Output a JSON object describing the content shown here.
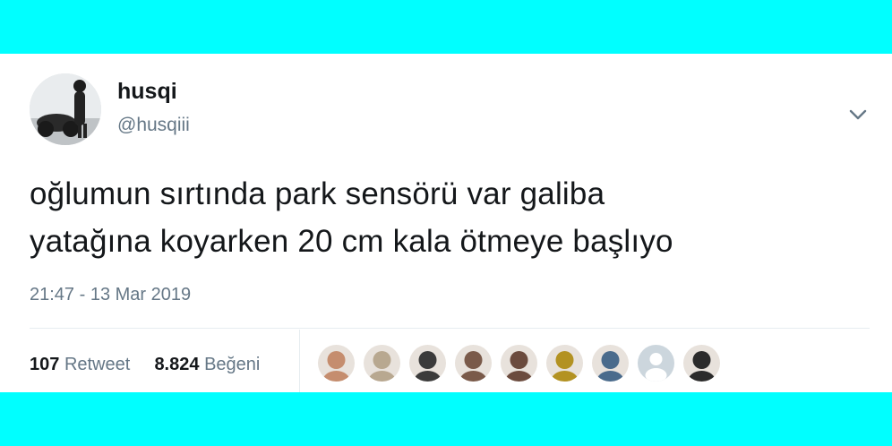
{
  "tweet": {
    "display_name": "husqi",
    "handle": "@husqiii",
    "text_lines": [
      "oğlumun sırtında park sensörü var galiba",
      "yatağına koyarken 20 cm kala ötmeye başlıyo"
    ],
    "timestamp": "21:47 - 13 Mar 2019",
    "retweet_count": "107",
    "retweet_label": "Retweet",
    "like_count": "8.824",
    "like_label": "Beğeni"
  },
  "likers": [
    {
      "icon": "user-avatar-photo",
      "color": "#c58d6e"
    },
    {
      "icon": "user-avatar-photo",
      "color": "#b8a890"
    },
    {
      "icon": "user-avatar-photo",
      "color": "#3b3b3b"
    },
    {
      "icon": "user-avatar-photo",
      "color": "#7a5a4a"
    },
    {
      "icon": "user-avatar-photo",
      "color": "#6b4b3e"
    },
    {
      "icon": "user-avatar-photo",
      "color": "#b39222"
    },
    {
      "icon": "user-avatar-photo",
      "color": "#4a6b8c"
    },
    {
      "icon": "default-avatar-icon",
      "color": "#ccd6dd"
    },
    {
      "icon": "user-avatar-photo",
      "color": "#2b2b2b"
    }
  ],
  "colors": {
    "background": "#00FFFF",
    "card": "#FFFFFF",
    "primary_text": "#14171A",
    "secondary_text": "#657786"
  }
}
